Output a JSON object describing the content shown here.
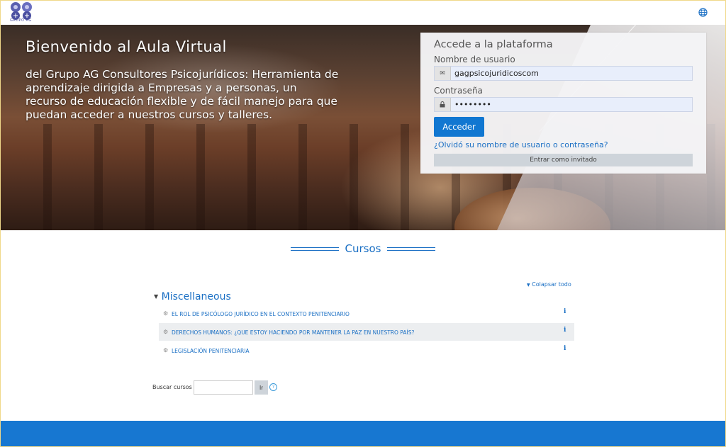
{
  "header": {
    "logo_caption": "GRUPO AG",
    "language_icon": "globe-icon"
  },
  "hero": {
    "welcome": "Bienvenido al Aula Virtual",
    "description": "del Grupo AG Consultores Psicojurídicos: Herramienta de aprendizaje dirigida a Empresas y a personas, un recurso de educación flexible y de fácil manejo para que puedan acceder a nuestros cursos y talleres."
  },
  "login": {
    "title": "Accede a la plataforma",
    "username_label": "Nombre de usuario",
    "username_value": "gagpsicojuridicoscom",
    "password_label": "Contraseña",
    "password_value": "••••••••",
    "submit_label": "Acceder",
    "forgot_link": "¿Olvidó su nombre de usuario o contraseña?",
    "guest_label": "Entrar como invitado"
  },
  "courses": {
    "section_title": "Cursos",
    "collapse_label": "Colapsar todo",
    "category": "Miscellaneous",
    "items": [
      {
        "title": "EL ROL DE PSICÓLOGO JURÍDICO EN EL CONTEXTO PENITENCIARIO"
      },
      {
        "title": "DERECHOS HUMANOS: ¿QUE ESTOY HACIENDO POR MANTENER LA PAZ EN NUESTRO PAÍS?"
      },
      {
        "title": "LEGISLACIÓN PENITENCIARIA"
      }
    ],
    "info_glyph": "i"
  },
  "search": {
    "label": "Buscar cursos",
    "value": "",
    "button_label": "Ir",
    "help_glyph": "?"
  },
  "colors": {
    "accent": "#1177d1",
    "link": "#1a6fc4",
    "footer": "#1777d1"
  }
}
